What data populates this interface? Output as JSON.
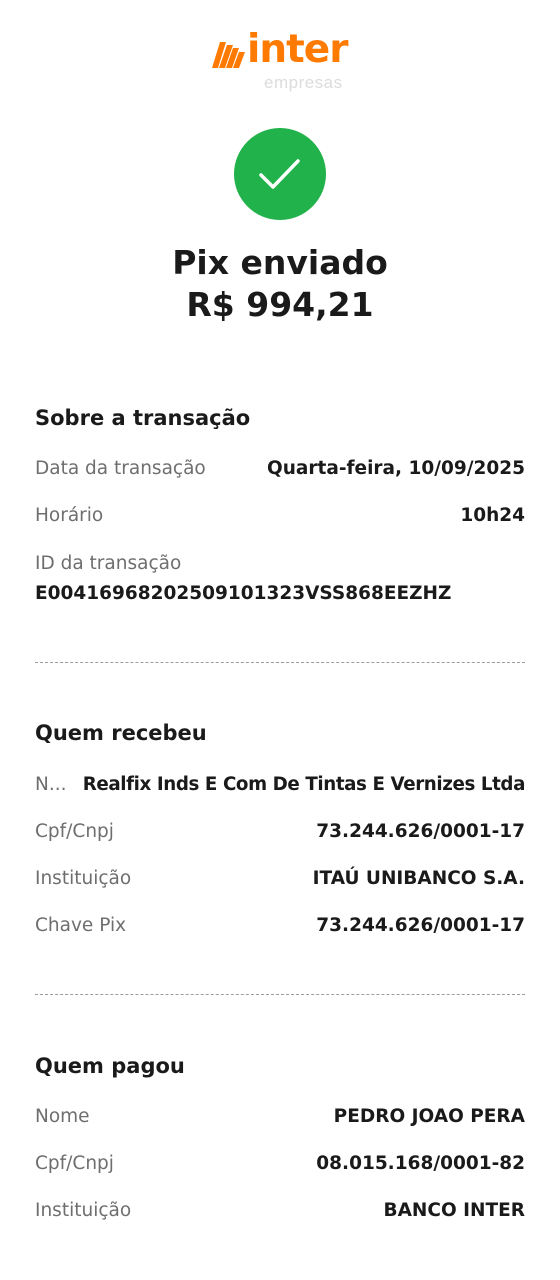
{
  "brand": {
    "name": "inter",
    "sub": "empresas",
    "color": "#ff7a00"
  },
  "status": {
    "icon": "check-icon",
    "color": "#21b24b",
    "title": "Pix enviado",
    "amount": "R$ 994,21"
  },
  "transaction": {
    "title": "Sobre a transação",
    "date_label": "Data da transação",
    "date_value": "Quarta-feira, 10/09/2025",
    "time_label": "Horário",
    "time_value": "10h24",
    "id_label": "ID da transação",
    "id_value": "E00416968202509101323VSS868EEZHZ"
  },
  "receiver": {
    "title": "Quem recebeu",
    "name_label": "N...",
    "name_value": "Realfix Inds E Com De Tintas E Vernizes Ltda",
    "doc_label": "Cpf/Cnpj",
    "doc_value": "73.244.626/0001-17",
    "institution_label": "Instituição",
    "institution_value": "ITAÚ UNIBANCO S.A.",
    "key_label": "Chave Pix",
    "key_value": "73.244.626/0001-17"
  },
  "payer": {
    "title": "Quem pagou",
    "name_label": "Nome",
    "name_value": "PEDRO JOAO PERA",
    "doc_label": "Cpf/Cnpj",
    "doc_value": "08.015.168/0001-82",
    "institution_label": "Instituição",
    "institution_value": "BANCO INTER"
  }
}
